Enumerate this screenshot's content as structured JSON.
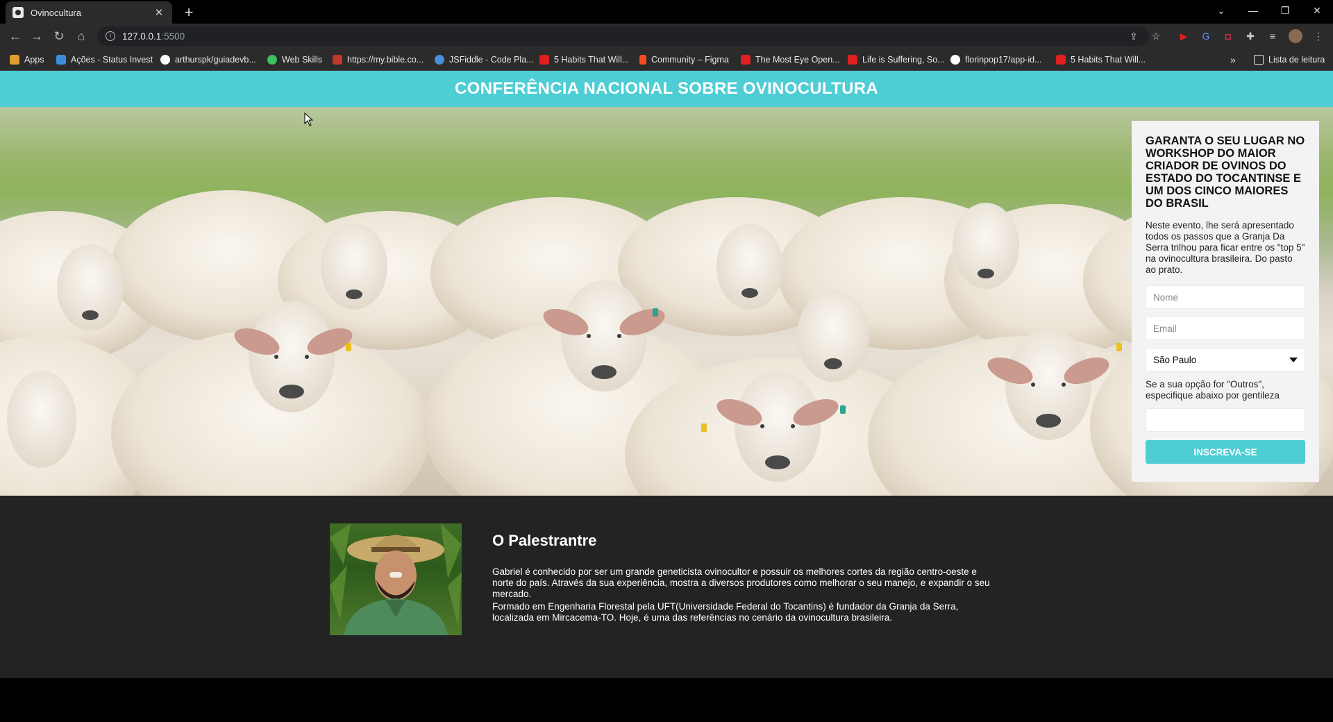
{
  "browser": {
    "tab_title": "Ovinocultura",
    "url_host": "127.0.0.1",
    "url_port": ":5500",
    "bookmarks": [
      {
        "label": "Apps",
        "color": "#e0a030"
      },
      {
        "label": "Ações - Status Invest",
        "color": "#3a8fd8"
      },
      {
        "label": "arthurspk/guiadevb...",
        "color": "#ffffff"
      },
      {
        "label": "Web Skills",
        "color": "#3fbf5f"
      },
      {
        "label": "https://my.bible.co...",
        "color": "#c0392b"
      },
      {
        "label": "JSFiddle - Code Pla...",
        "color": "#4a90d9"
      },
      {
        "label": "5 Habits That Will...",
        "color": "#e02020"
      },
      {
        "label": "Community – Figma",
        "color": "#f24e1e"
      },
      {
        "label": "The Most Eye Open...",
        "color": "#e02020"
      },
      {
        "label": "Life is Suffering, So...",
        "color": "#e02020"
      },
      {
        "label": "florinpop17/app-id...",
        "color": "#ffffff"
      },
      {
        "label": "5 Habits That Will...",
        "color": "#e02020"
      }
    ],
    "reading_list": "Lista de leitura"
  },
  "header": {
    "title": "CONFERÊNCIA NACIONAL SOBRE OVINOCULTURA"
  },
  "form": {
    "heading": "GARANTA O SEU LUGAR NO WORKSHOP DO MAIOR CRIADOR DE OVINOS DO ESTADO DO TOCANTINSE E UM DOS CINCO MAIORES DO BRASIL",
    "description": "Neste evento, lhe será apresentado todos os passos que a Granja Da Serra trilhou para ficar entre os \"top 5\" na ovinocultura brasileira. Do pasto ao prato.",
    "name_placeholder": "Nome",
    "email_placeholder": "Email",
    "state_selected": "São Paulo",
    "other_note": "Se a sua opção for \"Outros\", especifique abaixo por gentileza",
    "other_value": "",
    "submit_label": "INSCREVA-SE"
  },
  "speaker": {
    "heading": "O Palestrantre",
    "bio_1": "Gabriel é conhecido por ser um grande geneticista ovinocultor e possuir os melhores cortes da região centro-oeste e norte do país. Através da sua experiência, mostra a diversos produtores como melhorar o seu manejo, e expandir o seu mercado.",
    "bio_2": "Formado em Engenharia Florestal pela UFT(Universidade Federal do Tocantins) é fundador da Granja da Serra, localizada em Mircacema-TO. Hoje, é uma das referências no cenário da ovinocultura brasileira."
  },
  "colors": {
    "accent": "#4ecdd4",
    "dark_section": "#232323"
  }
}
